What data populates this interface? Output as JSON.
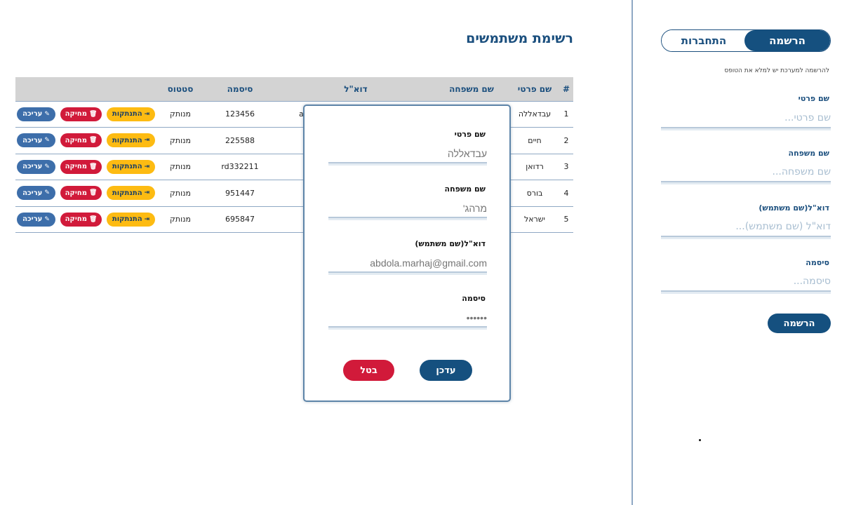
{
  "side": {
    "tab_login": "התחברות",
    "tab_register": "הרשמה",
    "hint": "להרשמה למערכת יש למלא את הטופס",
    "first_label": "שם פרטי",
    "first_placeholder": "שם פרטי...",
    "last_label": "שם משפחה",
    "last_placeholder": "שם משפחה...",
    "email_label": "דוא\"ל(שם משתמש)",
    "email_placeholder": "דוא\"ל (שם משתמש)...",
    "password_label": "סיסמה",
    "password_placeholder": "סיסמה...",
    "submit": "הרשמה"
  },
  "main": {
    "title": "רשימת משתמשים",
    "columns": [
      "#",
      "שם פרטי",
      "שם משפחה",
      "דוא\"ל",
      "סיסמה",
      "סטטוס"
    ],
    "email_peek": "a",
    "actions": {
      "logout": "התנתקות",
      "delete": "מחיקה",
      "edit": "עריכה"
    },
    "rows": [
      {
        "num": "1",
        "first": "עבדאללה",
        "last": "",
        "email": "",
        "password": "123456",
        "status": "מנותק"
      },
      {
        "num": "2",
        "first": "חיים",
        "last": "",
        "email": "",
        "password": "225588",
        "status": "מנותק"
      },
      {
        "num": "3",
        "first": "רדואן",
        "last": "",
        "email": "",
        "password": "rd332211",
        "status": "מנותק"
      },
      {
        "num": "4",
        "first": "בורס",
        "last": "",
        "email": "",
        "password": "951447",
        "status": "מנותק"
      },
      {
        "num": "5",
        "first": "ישראל",
        "last": "",
        "email": "",
        "password": "695847",
        "status": "מנותק"
      }
    ]
  },
  "modal": {
    "first_label": "שם פרטי",
    "first_placeholder": "עבדאללה",
    "last_label": "שם משפחה",
    "last_placeholder": "מרהג'",
    "email_label": "דוא\"ל(שם משתמש)",
    "email_placeholder": "abdola.marhaj@gmail.com",
    "password_label": "סיסמה",
    "password_value": "••••••",
    "update": "עדכן",
    "cancel": "בטל"
  },
  "colors": {
    "primary": "#15507f",
    "danger": "#d11a3a",
    "warning": "#fdbb12",
    "edit": "#3d6eaa"
  }
}
